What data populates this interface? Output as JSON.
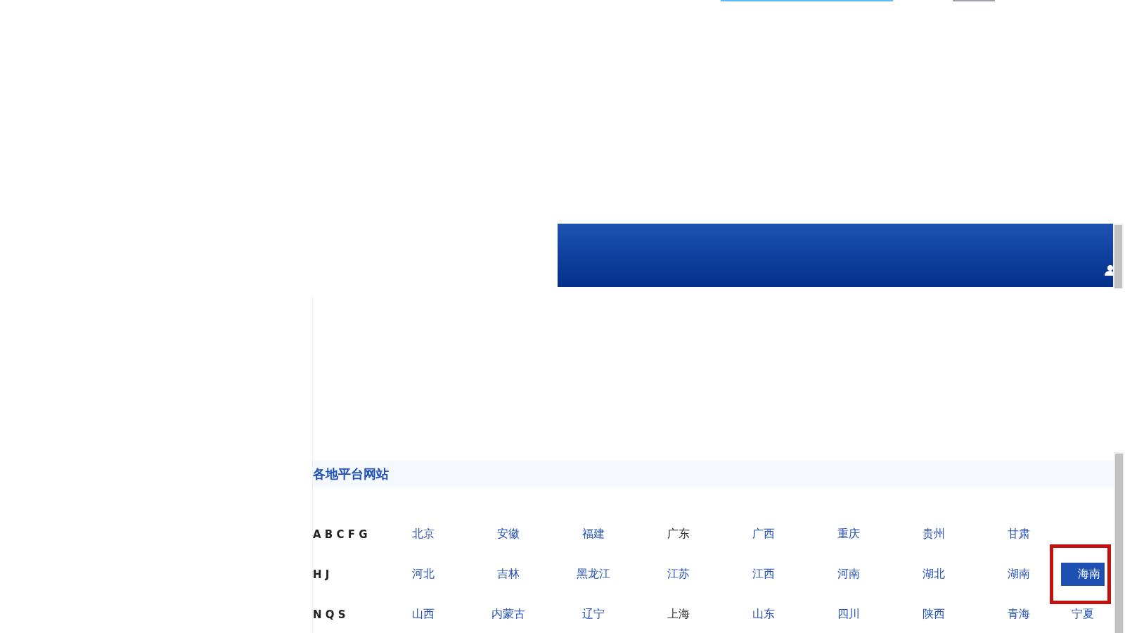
{
  "section": {
    "title": "各地平台网站"
  },
  "rows": [
    {
      "letters": "A B C F G",
      "provinces": [
        {
          "name": "北京",
          "visited": false,
          "selected": false
        },
        {
          "name": "安徽",
          "visited": false,
          "selected": false
        },
        {
          "name": "福建",
          "visited": false,
          "selected": false
        },
        {
          "name": "广东",
          "visited": true,
          "selected": false
        },
        {
          "name": "广西",
          "visited": false,
          "selected": false
        },
        {
          "name": "重庆",
          "visited": false,
          "selected": false
        },
        {
          "name": "贵州",
          "visited": false,
          "selected": false
        },
        {
          "name": "甘肃",
          "visited": false,
          "selected": false
        }
      ]
    },
    {
      "letters": "H J",
      "provinces": [
        {
          "name": "河北",
          "visited": false,
          "selected": false
        },
        {
          "name": "吉林",
          "visited": false,
          "selected": false
        },
        {
          "name": "黑龙江",
          "visited": false,
          "selected": false
        },
        {
          "name": "江苏",
          "visited": false,
          "selected": false
        },
        {
          "name": "江西",
          "visited": false,
          "selected": false
        },
        {
          "name": "河南",
          "visited": false,
          "selected": false
        },
        {
          "name": "湖北",
          "visited": false,
          "selected": false
        },
        {
          "name": "湖南",
          "visited": false,
          "selected": false
        },
        {
          "name": "海南",
          "visited": false,
          "selected": true
        }
      ]
    },
    {
      "letters": "N Q S",
      "provinces": [
        {
          "name": "山西",
          "visited": false,
          "selected": false
        },
        {
          "name": "内蒙古",
          "visited": false,
          "selected": false
        },
        {
          "name": "辽宁",
          "visited": false,
          "selected": false
        },
        {
          "name": "上海",
          "visited": true,
          "selected": false
        },
        {
          "name": "山东",
          "visited": false,
          "selected": false
        },
        {
          "name": "四川",
          "visited": false,
          "selected": false
        },
        {
          "name": "陕西",
          "visited": false,
          "selected": false
        },
        {
          "name": "青海",
          "visited": false,
          "selected": false
        },
        {
          "name": "宁夏",
          "visited": false,
          "selected": false
        }
      ]
    }
  ]
}
